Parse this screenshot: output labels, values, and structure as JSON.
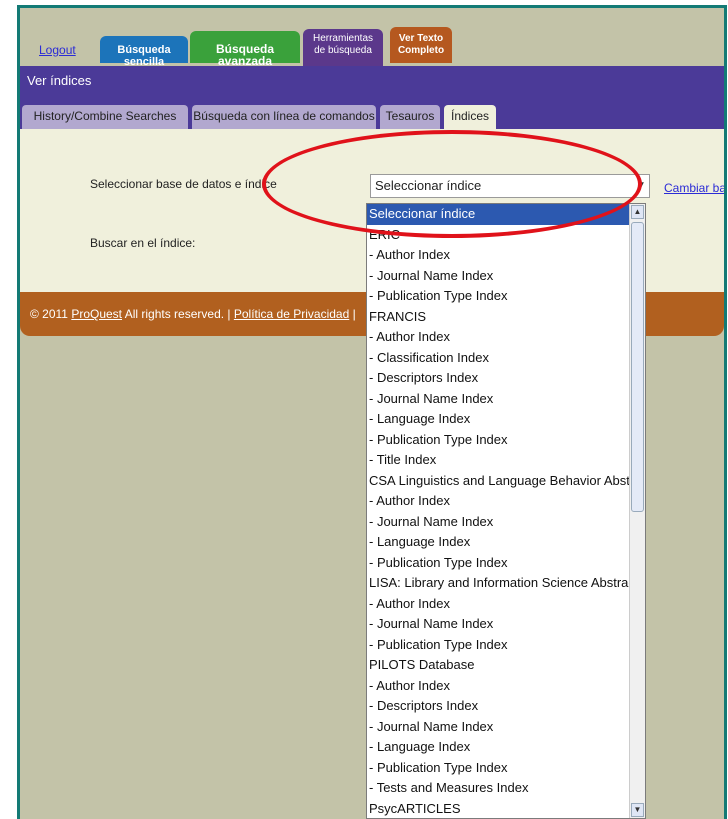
{
  "top_nav": {
    "logout": "Logout",
    "basic_search": "Búsqueda sencilla",
    "advanced_search": "Búsqueda avanzada",
    "search_tools_line1": "Herramientas",
    "search_tools_line2": "de búsqueda",
    "fulltext_line1": "Ver Texto",
    "fulltext_line2": "Completo"
  },
  "page_title": "Ver índices",
  "subtabs": [
    "History/Combine Searches",
    "Búsqueda con línea de comandos",
    "Tesauros",
    "Índices"
  ],
  "form": {
    "select_db_label": "Seleccionar base de datos e índice",
    "search_index_label": "Buscar en el índice:",
    "select_value": "Seleccionar índice",
    "change_link": "Cambiar ba"
  },
  "footer": {
    "copyright_pre": "© 2011 ",
    "proquest": "ProQuest",
    "rights": " All rights reserved. | ",
    "privacy": "Política de Privacidad",
    "sep": " | "
  },
  "dropdown_items": [
    "Seleccionar índice",
    "ERIC",
    "- Author Index",
    "- Journal Name Index",
    "- Publication Type Index",
    "FRANCIS",
    "- Author Index",
    "- Classification Index",
    "- Descriptors Index",
    "- Journal Name Index",
    "- Language Index",
    "- Publication Type Index",
    "- Title Index",
    "CSA Linguistics and Language Behavior Abstracts",
    "- Author Index",
    "- Journal Name Index",
    "- Language Index",
    "- Publication Type Index",
    "LISA: Library and Information Science Abstracts",
    "- Author Index",
    "- Journal Name Index",
    "- Publication Type Index",
    "PILOTS Database",
    "- Author Index",
    "- Descriptors Index",
    "- Journal Name Index",
    "- Language Index",
    "- Publication Type Index",
    "- Tests and Measures Index",
    "PsycARTICLES"
  ],
  "colors": {
    "highlight": "#e0121a",
    "title_bar": "#4b3a98",
    "footer": "#b1601f"
  }
}
